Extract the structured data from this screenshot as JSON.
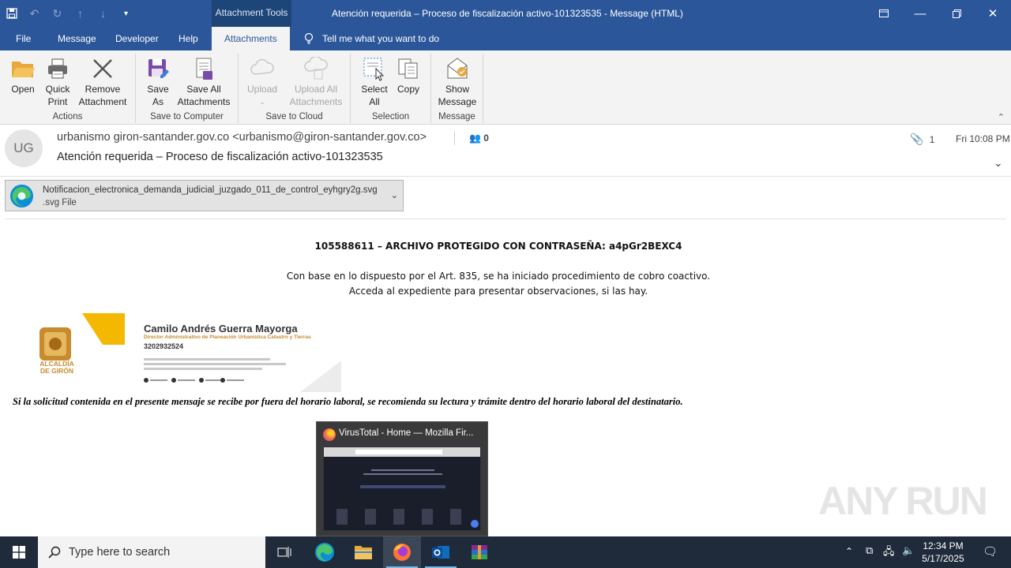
{
  "window": {
    "context_tab": "Attachment Tools",
    "title": "Atención requerida – Proceso de fiscalización activo-101323535  -  Message (HTML)"
  },
  "tabs": [
    "File",
    "Message",
    "Developer",
    "Help",
    "Attachments"
  ],
  "tell_me": "Tell me what you want to do",
  "ribbon": {
    "actions": {
      "label": "Actions",
      "open": "Open",
      "quick_print": "Quick Print",
      "remove_attachment": "Remove Attachment"
    },
    "save_to_computer": {
      "label": "Save to Computer",
      "save_as": "Save As",
      "save_all": "Save All Attachments"
    },
    "save_to_cloud": {
      "label": "Save to Cloud",
      "upload": "Upload",
      "upload_all": "Upload All Attachments"
    },
    "selection": {
      "label": "Selection",
      "select_all": "Select All",
      "copy": "Copy"
    },
    "message": {
      "label": "Message",
      "show_message": "Show Message"
    }
  },
  "header": {
    "initials": "UG",
    "from": "urbanismo giron-santander.gov.co <urbanismo@giron-santander.gov.co>",
    "subject": "Atención requerida – Proceso de fiscalización activo-101323535",
    "people_count": "0",
    "attachment_count": "1",
    "time": "Fri 10:08 PM"
  },
  "attachment": {
    "name": "Notificacion_electronica_demanda_judicial_juzgado_011_de_control_eyhgry2g.svg",
    "type": ".svg File"
  },
  "body": {
    "line1": "105588611   – ARCHIVO PROTEGIDO CON CONTRASEÑA:  a4pGr2BEXC4",
    "line2": "Con base en lo dispuesto por el Art. 835,  se ha iniciado procedimiento de cobro coactivo.",
    "line3": "Acceda al expediente para presentar observaciones, si las hay.",
    "footer": "Si la solicitud contenida en el presente mensaje se recibe por fuera del horario laboral, se recomienda su lectura y trámite dentro del horario laboral del destinatario."
  },
  "signature": {
    "name": "Camilo Andrés Guerra Mayorga",
    "role": "Director Administrativo de Planeación Urbanística Catastro y Tierras",
    "phone": "3202932524",
    "logo_text": "ALCALDÍA DE GIRÓN"
  },
  "thumbnail": {
    "title": "VirusTotal - Home — Mozilla Fir..."
  },
  "watermark": "ANY RUN",
  "taskbar": {
    "search_placeholder": "Type here to search",
    "time": "12:34 PM",
    "date": "5/17/2025"
  },
  "colors": {
    "accent": "#2b579a",
    "taskbar": "#1f2a3a"
  }
}
